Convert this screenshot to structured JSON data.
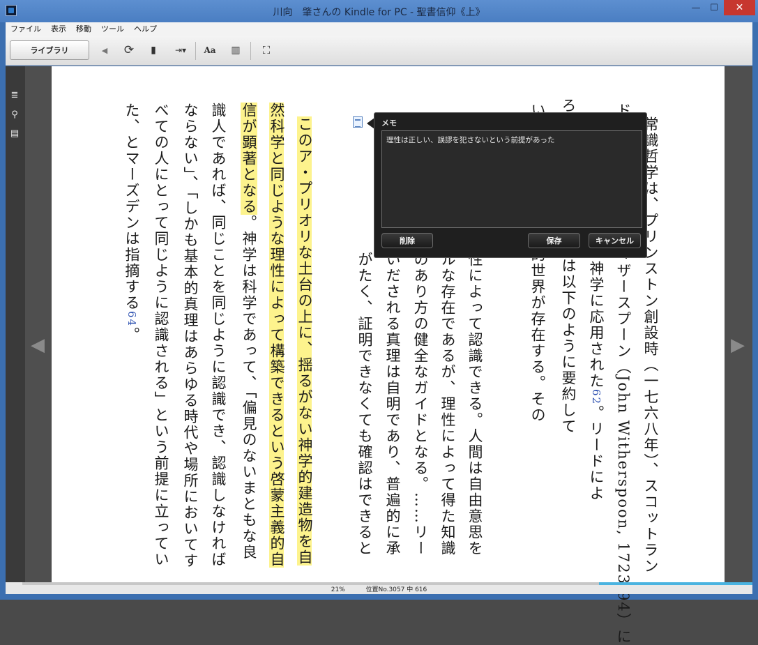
{
  "window": {
    "title": "川向　肇さんの Kindle for PC - 聖書信仰《上》",
    "minimize": "—",
    "maximize": "☐",
    "close": "✕"
  },
  "menu": [
    "ファイル",
    "表示",
    "移動",
    "ツール",
    "ヘルプ"
  ],
  "toolbar": {
    "library_label": "ライブラリ",
    "back": "◀",
    "sync": "⟳",
    "bookmark": "▮",
    "goto": "⇥▾",
    "font": "Aa",
    "view": "▥",
    "fullscreen": "⛶"
  },
  "sidebar": {
    "toc": "≣",
    "search": "⚲",
    "notes": "▤"
  },
  "nav": {
    "prev": "◀",
    "next": "▶"
  },
  "page": {
    "columns": [
      "常識哲学は、プリンストン創設時（一七六八年）、スコットラン",
      "ド長老教会牧師のウィザースプーン（John Witherspoon, 1723-94）に",
      "よってプリンストン神学に応用された",
      "ろう信をエイブラハムは以下のように要約して",
      "い物質からなる客観的世界が存在する。その",
      "性によって認識できる。人間は自由意思を",
      "ルな存在であるが、理性によって得た知識",
      "のあり方の健全なガイドとなる。……リー",
      "いだされる真理は自明であり、普遍的に承",
      "がたく、証明できなくても確認はできると",
      "",
      "このア・プリオリな土台の上に、揺るがない神学的建造物を自",
      "然科学と同じような理性によって構築できるという啓蒙主義的自",
      "信が顕著となる",
      "識人であれば、同じことを同じように認識でき、認識しなければ",
      "ならない」、「しかも基本的真理はあらゆる時代や場所においてす",
      "べての人にとって同じように認識される」という前提に立ってい",
      "た、とマーズデンは指摘する"
    ],
    "footnote_62": "62",
    "col3_tail": "。リードによ",
    "col14_tail": "。神学は科学であって、「偏見のないまともな良",
    "footnote_64": "64",
    "period": "。"
  },
  "memo": {
    "title": "メモ",
    "text": "理性は正しい、誤謬を犯さないという前提があった",
    "delete_label": "削除",
    "save_label": "保存",
    "cancel_label": "キャンセル"
  },
  "status": {
    "percent": "21%",
    "location": "位置No.3057 中 616",
    "progress_fraction": 0.21
  }
}
